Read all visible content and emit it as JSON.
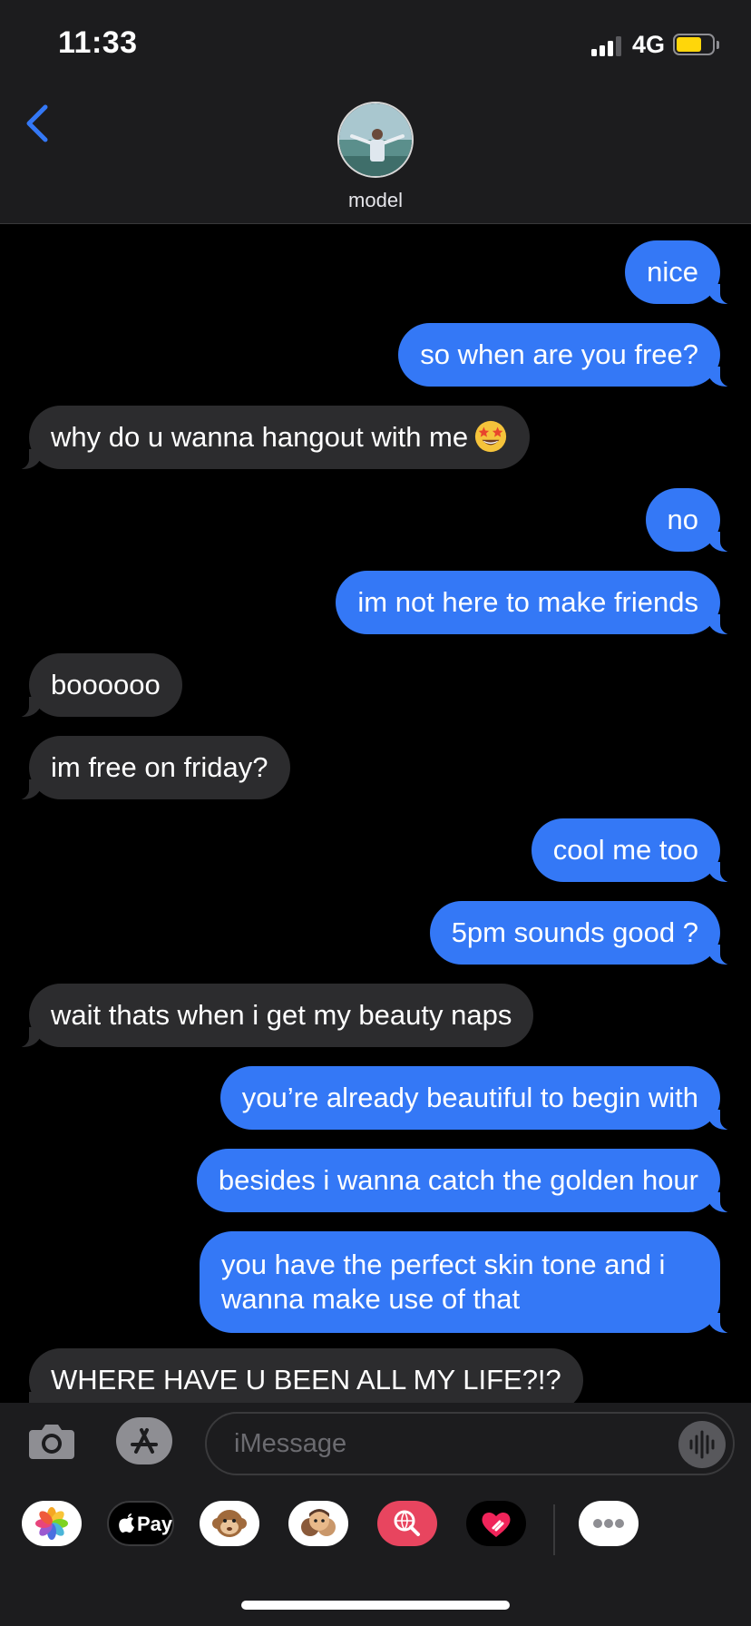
{
  "status_bar": {
    "time": "11:33",
    "network": "4G",
    "battery_level": 0.7,
    "signal_bars": 3
  },
  "header": {
    "contact_name": "model",
    "back_icon": "chevron-left-icon",
    "accent": "#3478f6"
  },
  "colors": {
    "sent_bubble": "#3478f6",
    "received_bubble": "#2c2c2e",
    "background": "#000000",
    "battery": "#ffd60a"
  },
  "messages": [
    {
      "from": "me",
      "text": "nice"
    },
    {
      "from": "me",
      "text": "so when are you free?"
    },
    {
      "from": "them",
      "text": "why do u wanna hangout with me",
      "emoji": "star-struck"
    },
    {
      "from": "me",
      "text": "no"
    },
    {
      "from": "me",
      "text": "im not here to make friends"
    },
    {
      "from": "them",
      "text": "boooooo"
    },
    {
      "from": "them",
      "text": "im free on friday?"
    },
    {
      "from": "me",
      "text": "cool me too"
    },
    {
      "from": "me",
      "text": "5pm sounds good ?"
    },
    {
      "from": "them",
      "text": "wait thats when i get my beauty naps"
    },
    {
      "from": "me",
      "text": "you’re already beautiful to begin with"
    },
    {
      "from": "me",
      "text": "besides i wanna catch the golden hour"
    },
    {
      "from": "me",
      "text": "you have the perfect skin tone and i wanna make use of that"
    },
    {
      "from": "them",
      "text": "WHERE HAVE U BEEN ALL MY LIFE?!?"
    }
  ],
  "composer": {
    "placeholder": "iMessage",
    "value": "",
    "camera_icon": "camera-icon",
    "apps_icon": "app-store-icon",
    "voice_icon": "audio-waveform-icon"
  },
  "app_drawer": [
    {
      "name": "photos",
      "icon": "photos-flower-icon"
    },
    {
      "name": "apple-pay",
      "label": "Pay",
      "icon": "apple-logo-icon"
    },
    {
      "name": "animoji",
      "icon": "monkey-icon"
    },
    {
      "name": "memoji",
      "icon": "memoji-faces-icon"
    },
    {
      "name": "gif-search",
      "icon": "globe-search-icon"
    },
    {
      "name": "digital-touch",
      "icon": "heart-touch-icon"
    },
    {
      "name": "more",
      "icon": "ellipsis-icon"
    }
  ]
}
